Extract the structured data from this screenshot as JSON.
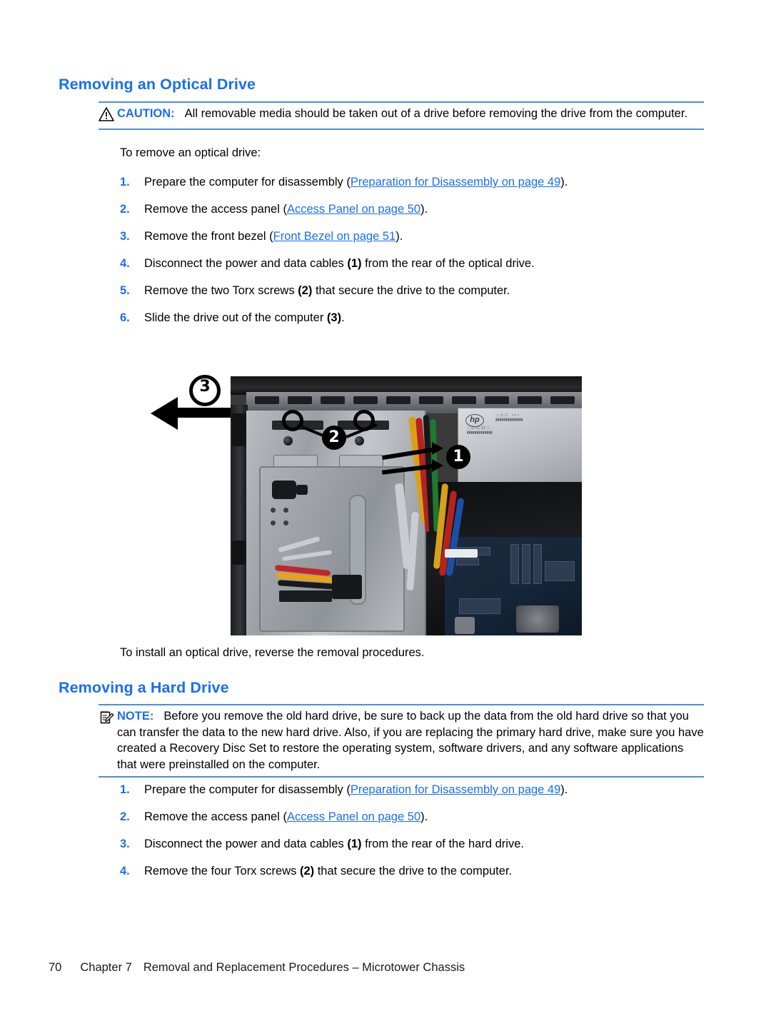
{
  "document": {
    "page_number": "70",
    "chapter_label": "Chapter 7",
    "chapter_title": "Removal and Replacement Procedures – Microtower Chassis"
  },
  "colors": {
    "heading_blue": "#1a6ef5",
    "link_blue": "#1a6ef5",
    "rule_blue": "#4a90d9",
    "body_text": "#000000"
  },
  "sections": {
    "optical": {
      "heading": "Removing an Optical Drive",
      "caution": {
        "icon": "warning-triangle-icon",
        "label": "CAUTION:",
        "text": "All removable media should be taken out of a drive before removing the drive from the computer."
      },
      "intro": "To remove an optical drive:",
      "steps": [
        {
          "num": "1.",
          "pre": "Prepare the computer for disassembly (",
          "link": "Preparation for Disassembly on page 49",
          "post": ")."
        },
        {
          "num": "2.",
          "pre": "Remove the access panel (",
          "link": "Access Panel on page 50",
          "post": ")."
        },
        {
          "num": "3.",
          "pre": "Remove the front bezel (",
          "link": "Front Bezel on page 51",
          "post": ")."
        },
        {
          "num": "4.",
          "pre": "Disconnect the power and data cables ",
          "callout": "(1)",
          "post": " from the rear of the optical drive."
        },
        {
          "num": "5.",
          "pre": "Remove the two Torx screws ",
          "callout": "(2)",
          "post": " that secure the drive to the computer."
        },
        {
          "num": "6.",
          "pre": "Slide the drive out of the computer ",
          "callout": "(3)",
          "post": "."
        }
      ],
      "outro": "To install an optical drive, reverse the removal procedures."
    },
    "hard_drive": {
      "heading": "Removing a Hard Drive",
      "note": {
        "icon": "notepad-pencil-icon",
        "label": "NOTE:",
        "text": "Before you remove the old hard drive, be sure to back up the data from the old hard drive so that you can transfer the data to the new hard drive. Also, if you are replacing the primary hard drive, make sure you have created a Recovery Disc Set to restore the operating system, software drivers, and any software applications that were preinstalled on the computer."
      },
      "steps": [
        {
          "num": "1.",
          "pre": "Prepare the computer for disassembly (",
          "link": "Preparation for Disassembly on page 49",
          "post": ")."
        },
        {
          "num": "2.",
          "pre": "Remove the access panel (",
          "link": "Access Panel on page 50",
          "post": ")."
        },
        {
          "num": "3.",
          "pre": "Disconnect the power and data cables ",
          "callout": "(1)",
          "post": " from the rear of the hard drive."
        },
        {
          "num": "4.",
          "pre": "Remove the four Torx screws ",
          "callout": "(2)",
          "post": " that secure the drive to the computer."
        }
      ]
    }
  },
  "figure": {
    "description": "Photograph of an open HP microtower chassis showing the optical drive bay, securing screws, and power supply with cables",
    "brand_mark": "hp",
    "callouts": [
      {
        "id": "1",
        "meaning": "power and data cables at rear of optical drive"
      },
      {
        "id": "2",
        "meaning": "two Torx screws securing the drive"
      },
      {
        "id": "3",
        "meaning": "direction to slide the drive out of the computer"
      }
    ]
  }
}
